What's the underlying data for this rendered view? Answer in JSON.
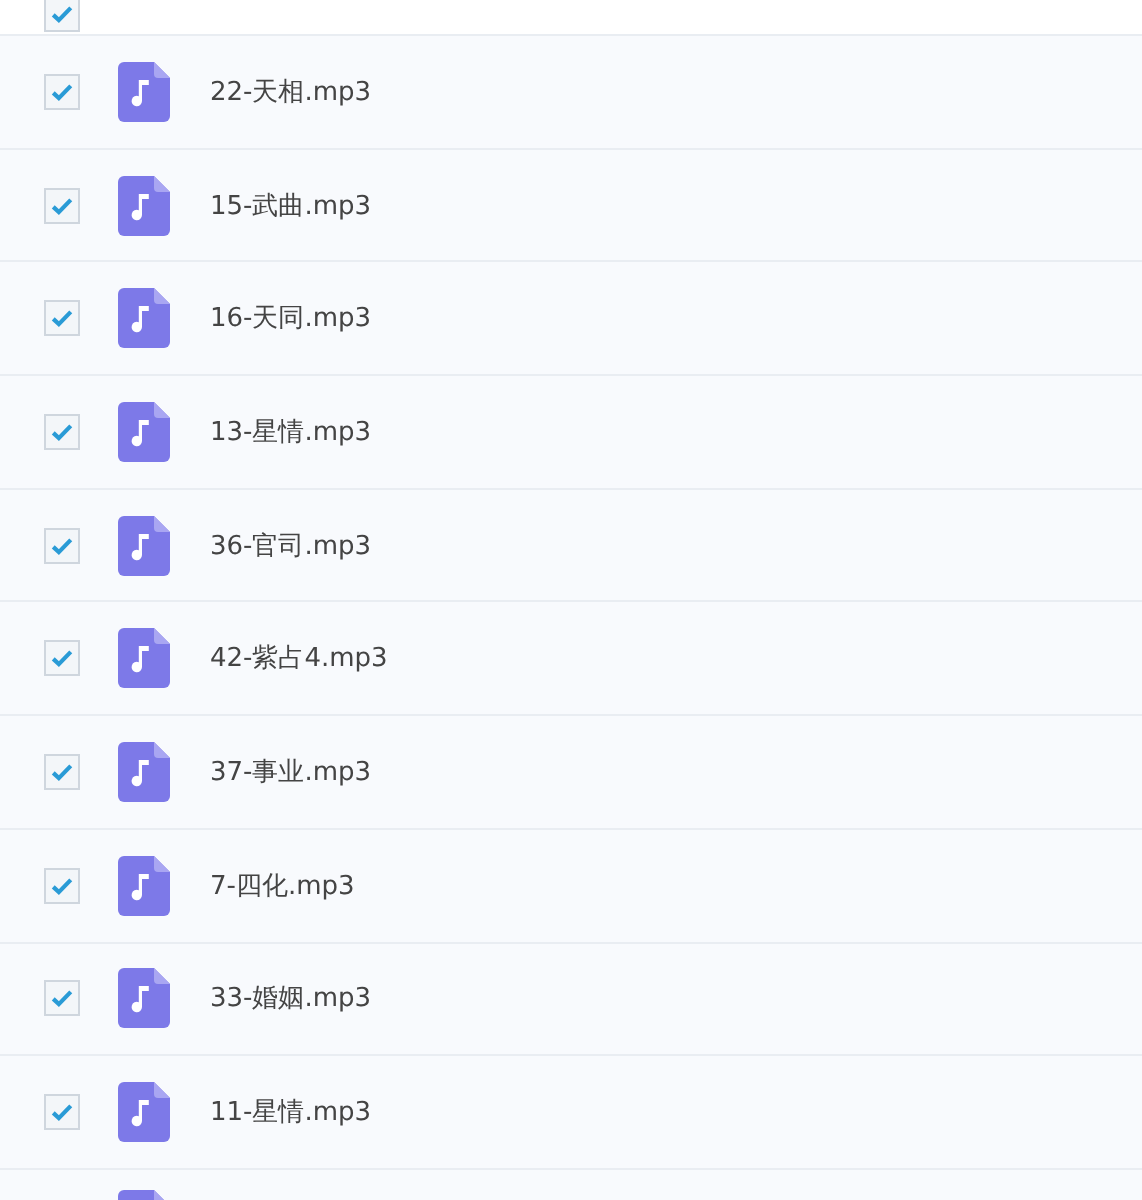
{
  "header": {
    "checked": true
  },
  "files": [
    {
      "name": "22-天相.mp3",
      "checked": true
    },
    {
      "name": "15-武曲.mp3",
      "checked": true
    },
    {
      "name": "16-天同.mp3",
      "checked": true
    },
    {
      "name": "13-星情.mp3",
      "checked": true
    },
    {
      "name": "36-官司.mp3",
      "checked": true
    },
    {
      "name": "42-紫占4.mp3",
      "checked": true
    },
    {
      "name": "37-事业.mp3",
      "checked": true
    },
    {
      "name": "7-四化.mp3",
      "checked": true
    },
    {
      "name": "33-婚姻.mp3",
      "checked": true
    },
    {
      "name": "11-星情.mp3",
      "checked": true
    },
    {
      "kind": "partial"
    }
  ]
}
